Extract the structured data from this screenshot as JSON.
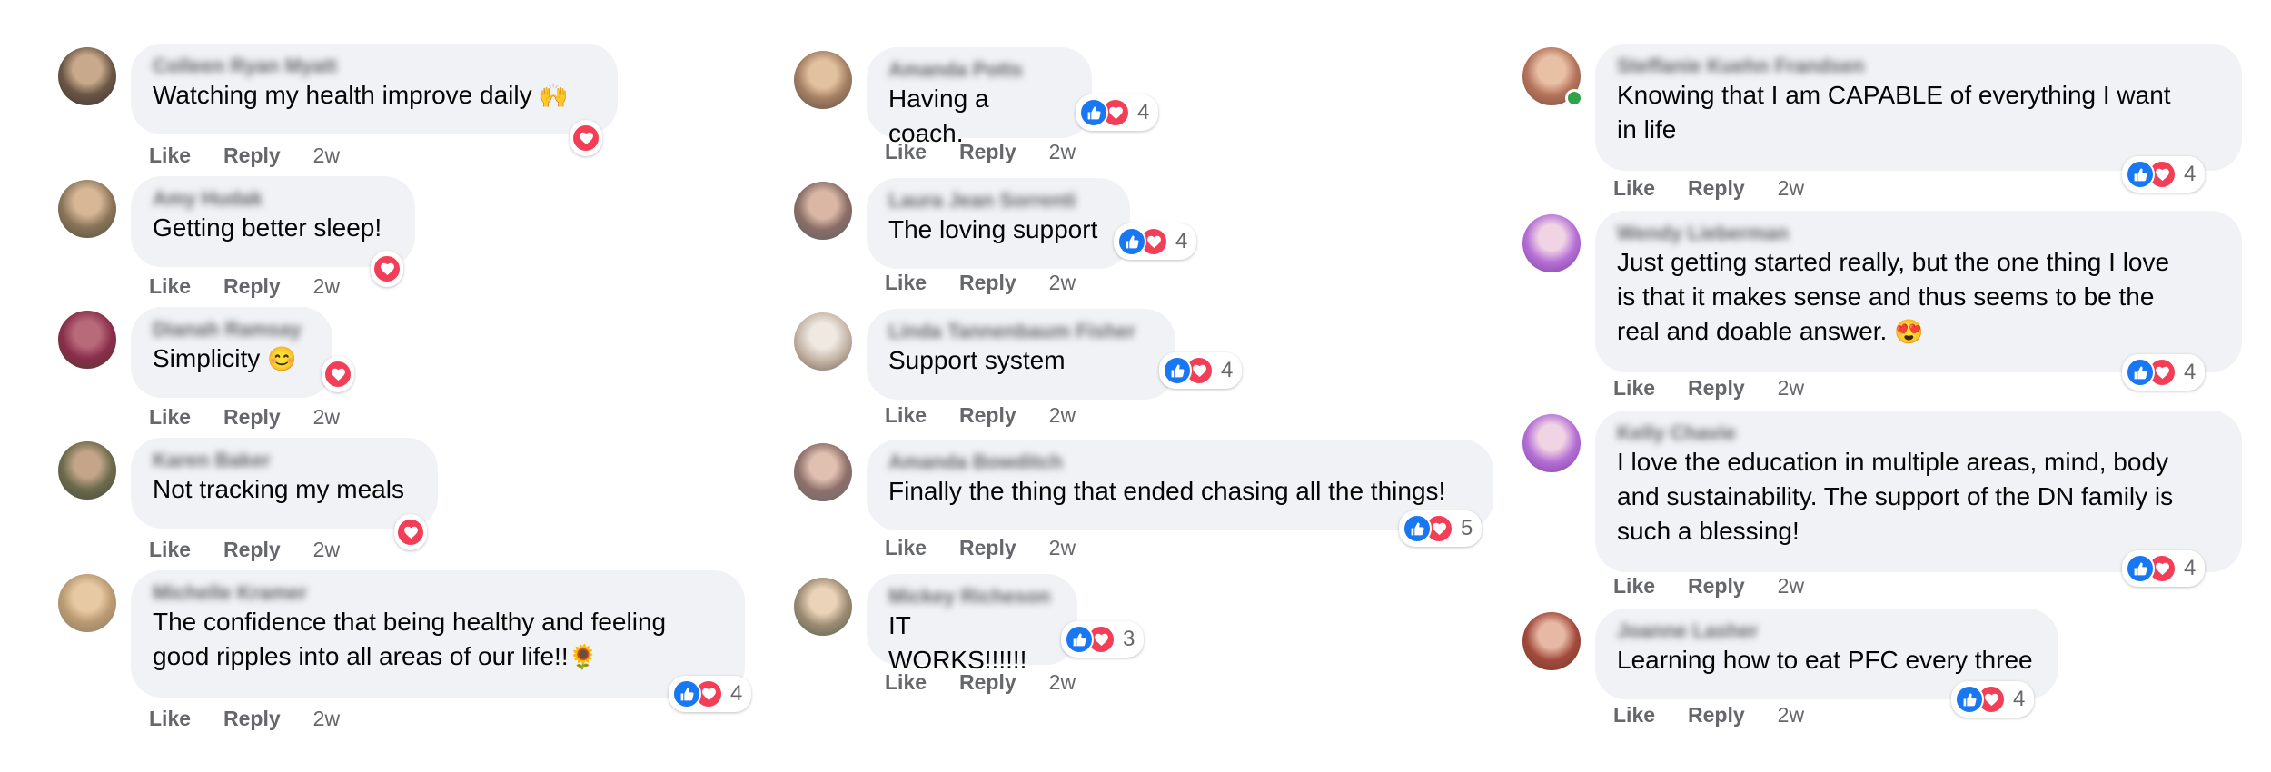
{
  "actions": {
    "like": "Like",
    "reply": "Reply"
  },
  "colors": {
    "bubble": "#f0f2f5",
    "like_blue": "#1877f2",
    "love_red": "#f33e58",
    "meta_gray": "#65676b"
  },
  "columns": [
    {
      "comments": [
        {
          "author": "Colleen Ryan Myatt",
          "text": "Watching my health improve daily",
          "emoji": "🙌",
          "time": "2w",
          "reactions": {
            "types": [
              "love-icon"
            ],
            "count": ""
          }
        },
        {
          "author": "Amy Hudak",
          "text": "Getting better sleep!",
          "emoji": "",
          "time": "2w",
          "reactions": {
            "types": [
              "love-icon"
            ],
            "count": ""
          }
        },
        {
          "author": "Dianah Ramsay",
          "text": "Simplicity",
          "emoji": "😊",
          "time": "2w",
          "reactions": {
            "types": [
              "love-icon"
            ],
            "count": ""
          }
        },
        {
          "author": "Karen Baker",
          "text": "Not tracking my meals",
          "emoji": "",
          "time": "2w",
          "reactions": {
            "types": [
              "love-icon"
            ],
            "count": ""
          }
        },
        {
          "author": "Michelle Kramer",
          "text_lines": [
            "The confidence that being healthy and feeling",
            "good ripples into all areas of our life!!"
          ],
          "emoji": "🌻",
          "time": "2w",
          "reactions": {
            "types": [
              "like-icon",
              "love-icon"
            ],
            "count": "4"
          }
        }
      ]
    },
    {
      "comments": [
        {
          "author": "Amanda Potts",
          "text": "Having a coach.",
          "emoji": "",
          "time": "2w",
          "reactions": {
            "types": [
              "like-icon",
              "love-icon"
            ],
            "count": "4"
          }
        },
        {
          "author": "Laura Jean Sorrenti",
          "text": "The loving support",
          "emoji": "",
          "time": "2w",
          "reactions": {
            "types": [
              "like-icon",
              "love-icon"
            ],
            "count": "4"
          }
        },
        {
          "author": "Linda Tannenbaum Fisher",
          "text": "Support system",
          "emoji": "",
          "time": "2w",
          "reactions": {
            "types": [
              "like-icon",
              "love-icon"
            ],
            "count": "4"
          }
        },
        {
          "author": "Amanda Bowditch",
          "text": "Finally the thing that ended chasing all the things!",
          "emoji": "",
          "time": "2w",
          "reactions": {
            "types": [
              "like-icon",
              "love-icon"
            ],
            "count": "5"
          }
        },
        {
          "author": "Mickey Richeson",
          "text": "IT WORKS!!!!!!",
          "emoji": "",
          "time": "2w",
          "reactions": {
            "types": [
              "like-icon",
              "love-icon"
            ],
            "count": "3"
          }
        }
      ]
    },
    {
      "comments": [
        {
          "author": "Steffanie Kuehn Frandsen",
          "text_lines": [
            "Knowing that I am CAPABLE of everything I want",
            "in life"
          ],
          "emoji": "",
          "time": "2w",
          "reactions": {
            "types": [
              "like-icon",
              "love-icon"
            ],
            "count": "4"
          }
        },
        {
          "author": "Wendy Lieberman",
          "text_lines": [
            "Just getting started really, but the one thing I love",
            "is that it makes sense and thus seems to be the",
            "real and doable answer."
          ],
          "emoji": "😍",
          "time": "2w",
          "reactions": {
            "types": [
              "like-icon",
              "love-icon"
            ],
            "count": "4"
          }
        },
        {
          "author": "Kelly Chavie",
          "text_lines": [
            "I love the education in multiple areas, mind, body",
            "and sustainability. The support of the DN family is",
            "such a blessing!"
          ],
          "emoji": "",
          "time": "2w",
          "reactions": {
            "types": [
              "like-icon",
              "love-icon"
            ],
            "count": "4"
          }
        },
        {
          "author": "Joanne Lasher",
          "text": "Learning how to eat PFC every three",
          "emoji": "",
          "time": "2w",
          "reactions": {
            "types": [
              "like-icon",
              "love-icon"
            ],
            "count": "4"
          }
        }
      ]
    }
  ]
}
